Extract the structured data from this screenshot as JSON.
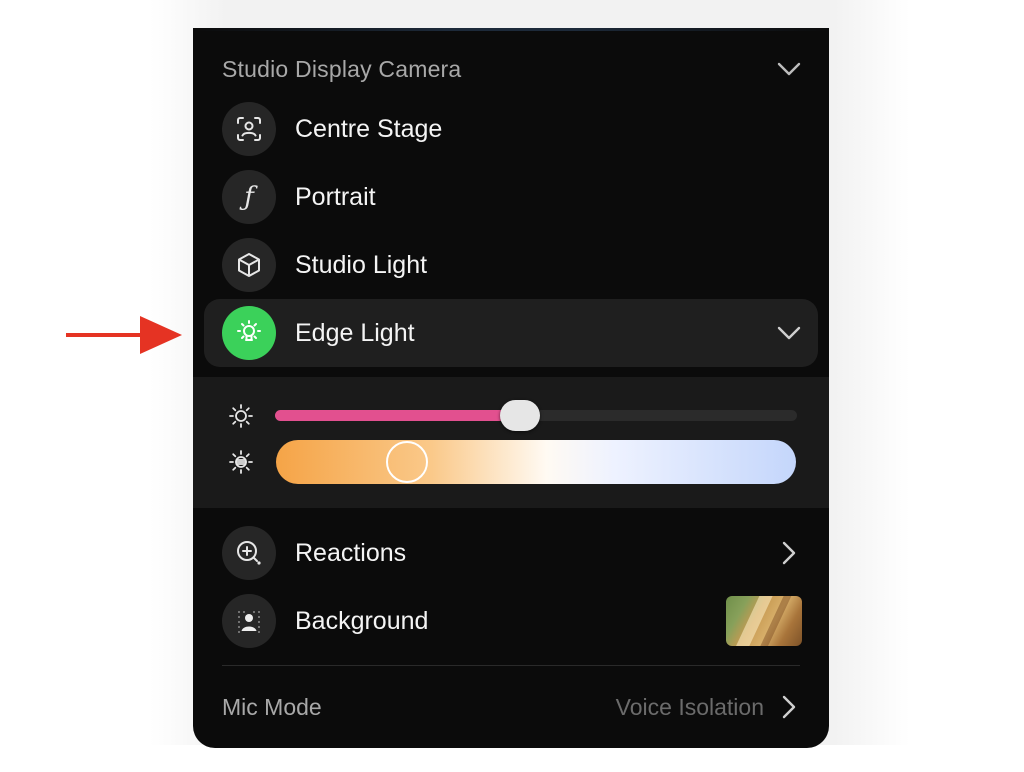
{
  "panel": {
    "header_title": "Studio Display Camera",
    "items": [
      {
        "label": "Centre Stage",
        "icon": "centre-stage-icon"
      },
      {
        "label": "Portrait",
        "icon": "portrait-f-icon"
      },
      {
        "label": "Studio Light",
        "icon": "cube-icon"
      },
      {
        "label": "Edge Light",
        "icon": "edge-light-icon",
        "active": true,
        "accent": "#3bd15a"
      }
    ],
    "brightness_slider": {
      "value_percent": 47,
      "fill_color": "#e2508f"
    },
    "temperature_slider": {
      "value_percent": 25
    },
    "reactions": {
      "label": "Reactions"
    },
    "background": {
      "label": "Background"
    },
    "mic_mode": {
      "label": "Mic Mode",
      "value": "Voice Isolation"
    }
  },
  "annotation": {
    "arrow_color": "#e53323"
  }
}
